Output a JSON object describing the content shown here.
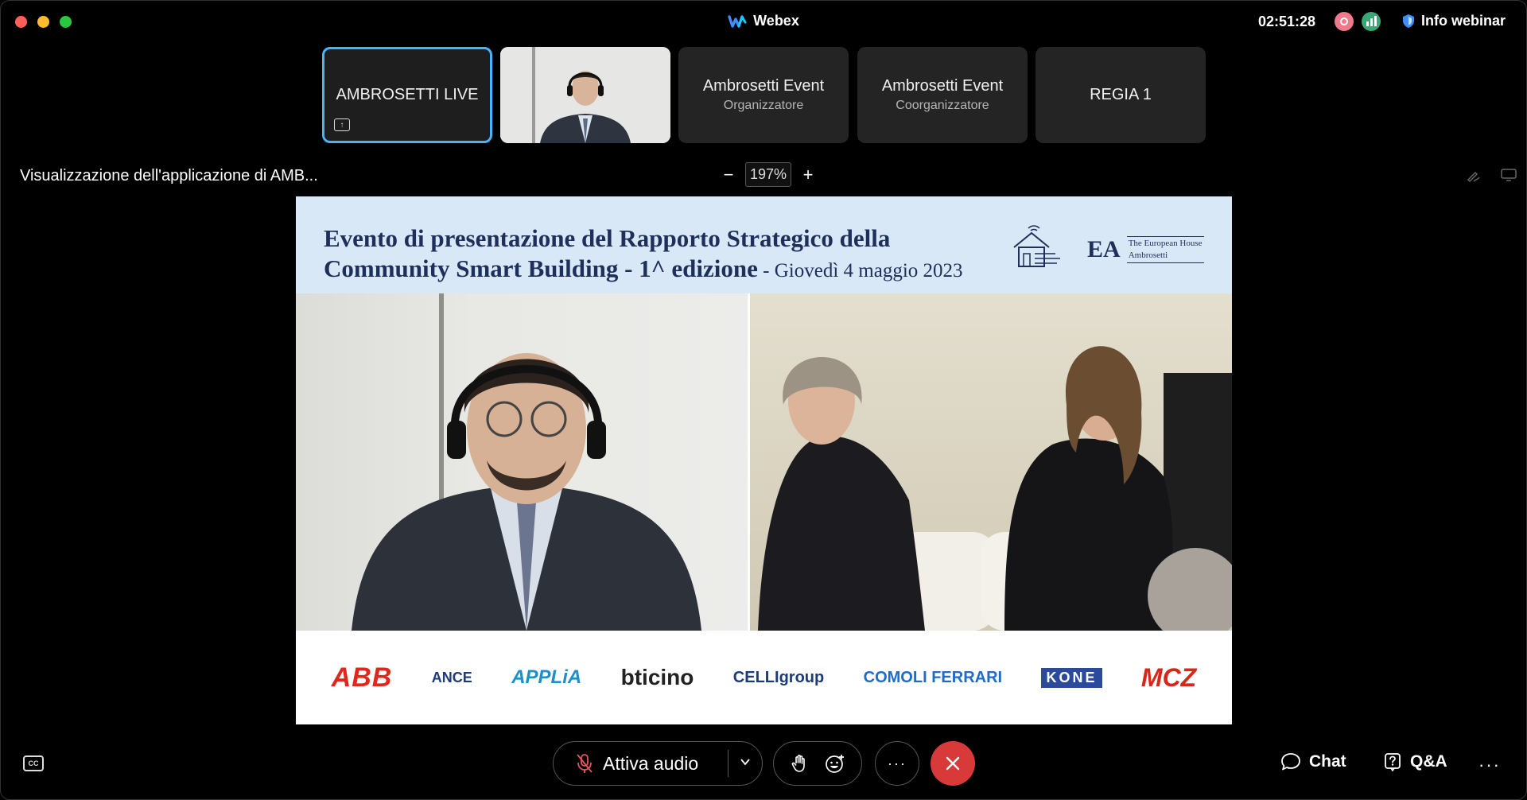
{
  "window": {
    "app_title": "Webex",
    "clock": "02:51:28",
    "info_label": "Info webinar"
  },
  "participants": [
    {
      "name": "AMBROSETTI LIVE",
      "role": "",
      "active": true
    },
    {
      "name": "",
      "role": "",
      "video": true
    },
    {
      "name": "Ambrosetti Event",
      "role": "Organizzatore"
    },
    {
      "name": "Ambrosetti Event",
      "role": "Coorganizzatore"
    },
    {
      "name": "REGIA 1",
      "role": ""
    }
  ],
  "share": {
    "label": "Visualizzazione dell'applicazione di AMB...",
    "zoom_minus": "−",
    "zoom_value": "197%",
    "zoom_plus": "+"
  },
  "slide": {
    "title_line1": "Evento di presentazione del Rapporto Strategico della",
    "title_line2": "Community Smart Building - 1^ edizione",
    "date": " - Giovedì 4 maggio 2023",
    "org_mark": "EA",
    "org_name_1": "The European House",
    "org_name_2": "Ambrosetti",
    "sponsors": [
      "ABB",
      "ANCE",
      "APPLiA",
      "bticino",
      "CELLIgroup",
      "COMOLI FERRARI",
      "KONE",
      "MCZ"
    ]
  },
  "controls": {
    "audio_label": "Attiva audio",
    "more_label": "···",
    "chat_label": "Chat",
    "qa_label": "Q&A",
    "overflow_label": "···"
  },
  "colors": {
    "active_tile_border": "#4ab3f4",
    "leave_red": "#d83a3a",
    "banner_bg": "#d9e8f6",
    "banner_text": "#1d2f5a"
  }
}
